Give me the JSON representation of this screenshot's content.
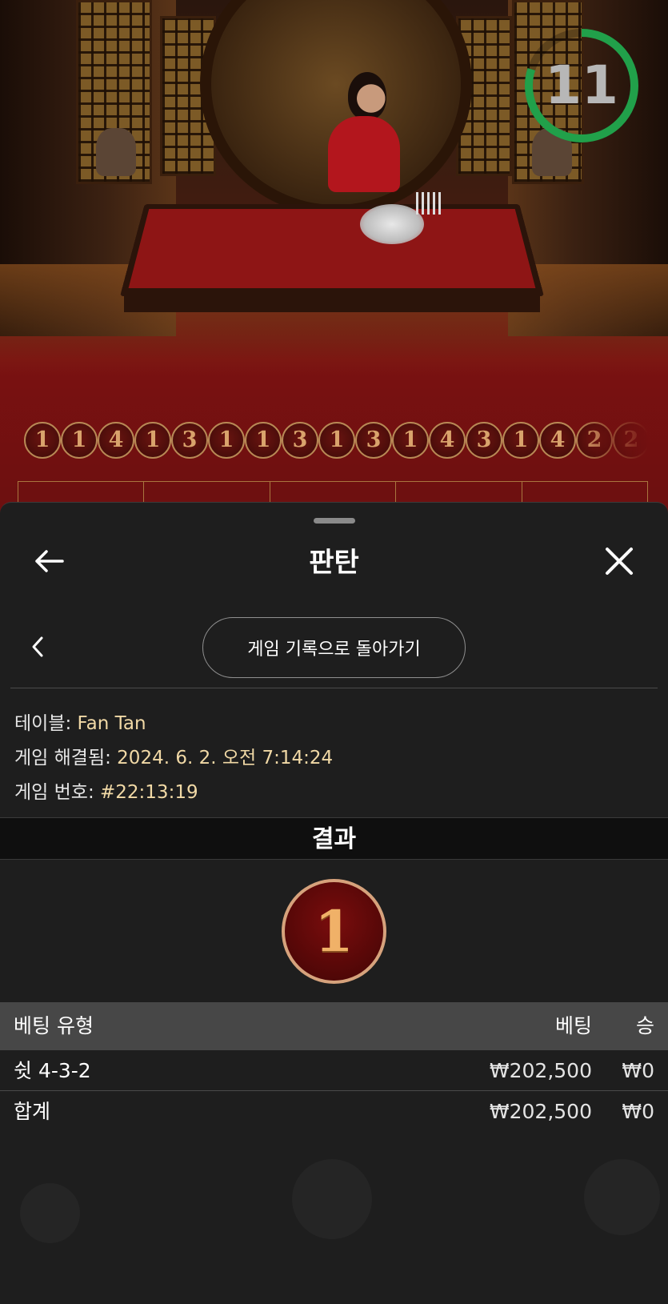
{
  "video": {
    "timer_value": "11",
    "timer_progress": 0.8,
    "timer_color": "#21a04a"
  },
  "road": [
    "1",
    "1",
    "4",
    "1",
    "3",
    "1",
    "1",
    "3",
    "1",
    "3",
    "1",
    "4",
    "3",
    "1",
    "4",
    "2",
    "2"
  ],
  "sheet": {
    "title": "판탄",
    "back_icon": "arrow-left-icon",
    "close_icon": "close-icon",
    "prev_icon": "chevron-left-icon",
    "history_button_label": "게임 기록으로 돌아가기"
  },
  "info": {
    "table_label": "테이블: ",
    "table_value": "Fan Tan",
    "resolved_label": "게임 해결됨: ",
    "resolved_value": "2024. 6. 2. 오전 7:14:24",
    "game_no_label": "게임 번호: ",
    "game_no_value": "#22:13:19"
  },
  "result": {
    "heading": "결과",
    "value": "1"
  },
  "bets_table": {
    "headers": {
      "type": "베팅 유형",
      "bet": "베팅",
      "win": "승"
    },
    "rows": [
      {
        "type": "쉿 4-3-2",
        "bet": "₩202,500",
        "win": "₩0"
      }
    ],
    "total": {
      "type": "합계",
      "bet": "₩202,500",
      "win": "₩0"
    }
  }
}
